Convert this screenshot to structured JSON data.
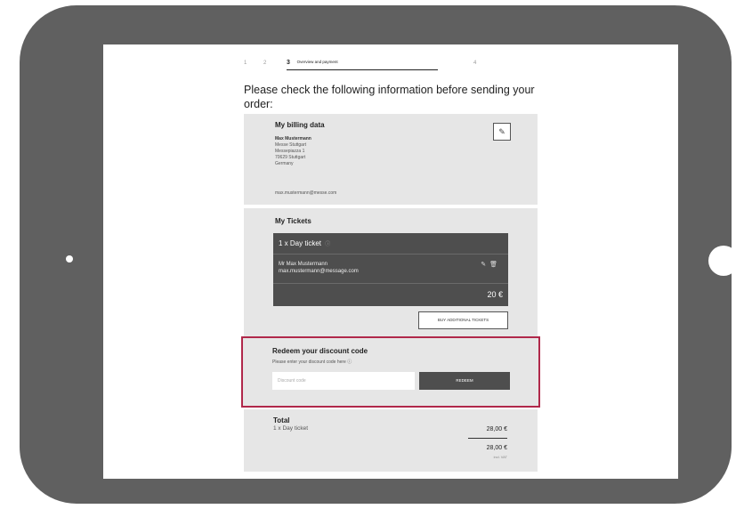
{
  "steps": {
    "step1": "1",
    "step2": "2",
    "step3": "3",
    "step3_label": "Overview and payment",
    "step4": "4"
  },
  "heading": "Please check the following information before sending your order:",
  "billing": {
    "title": "My billing data",
    "name": "Max Mustermann",
    "company": "Messe Stuttgart",
    "street": "Messepiazza 1",
    "city": "70629 Stuttgart",
    "country": "Germany",
    "email": "max.mustermann@messe.com",
    "edit_icon": "pencil-icon"
  },
  "tickets": {
    "title": "My Tickets",
    "card_title": "1 x Day ticket",
    "info_icon": "ⓘ",
    "holder_name": "Mr Max Mustermann",
    "holder_email": "max.mustermann@message.com",
    "price": "20 €",
    "add_button": "BUY ADDITIONAL TICKETS"
  },
  "discount": {
    "title": "Redeem your discount code",
    "hint": "Please enter your discount code here",
    "hint_icon": "ⓘ",
    "placeholder": "Discount code",
    "button": "REDEEM"
  },
  "total": {
    "title": "Total",
    "line_label": "1 x Day ticket",
    "line_value": "28,00 €",
    "sum_value": "28,00 €",
    "vat_note": "incl. VAT"
  },
  "colors": {
    "frame": "#606060",
    "panel": "#e6e6e6",
    "dark_card": "#4e4e4e",
    "highlight": "#b0284a"
  }
}
